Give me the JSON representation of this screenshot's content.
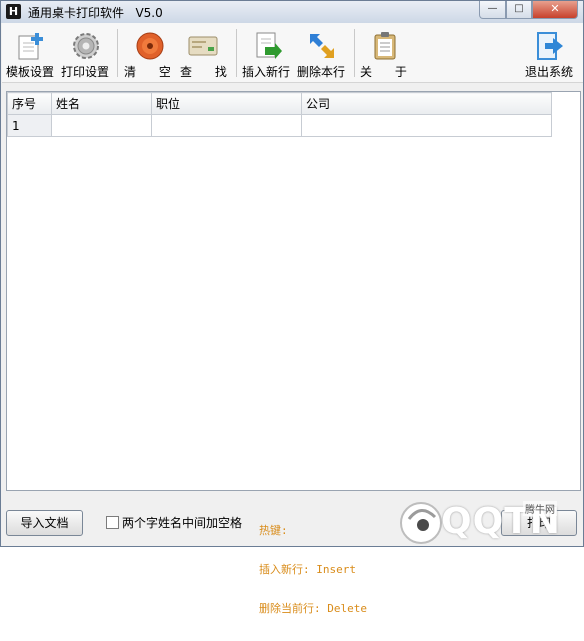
{
  "window": {
    "title": "通用桌卡打印软件   V5.0",
    "minimize_glyph": "—",
    "maximize_glyph": "□",
    "close_glyph": "✕"
  },
  "toolbar": {
    "template_settings": "模板设置",
    "print_settings": "打印设置",
    "clear": "清      空",
    "find": "查      找",
    "insert_row": "插入新行",
    "delete_row": "删除本行",
    "about": "关      于",
    "exit": "退出系统"
  },
  "grid": {
    "columns": [
      "序号",
      "姓名",
      "职位",
      "公司"
    ],
    "rows": [
      [
        "1",
        "",
        "",
        ""
      ]
    ]
  },
  "bottom": {
    "import_button": "导入文档",
    "checkbox_label": "两个字姓名中间加空格",
    "checkbox_checked": false,
    "hotkeys_title": "热键:",
    "hotkey_insert": "插入新行: Insert",
    "hotkey_delete": "删除当前行: Delete",
    "print_button": "打印"
  },
  "watermark": {
    "logo_text": "QQTN",
    "sub_text": "腾牛网"
  },
  "colors": {
    "hotkey_text": "#d98c1a",
    "close_button": "#c7412c"
  }
}
